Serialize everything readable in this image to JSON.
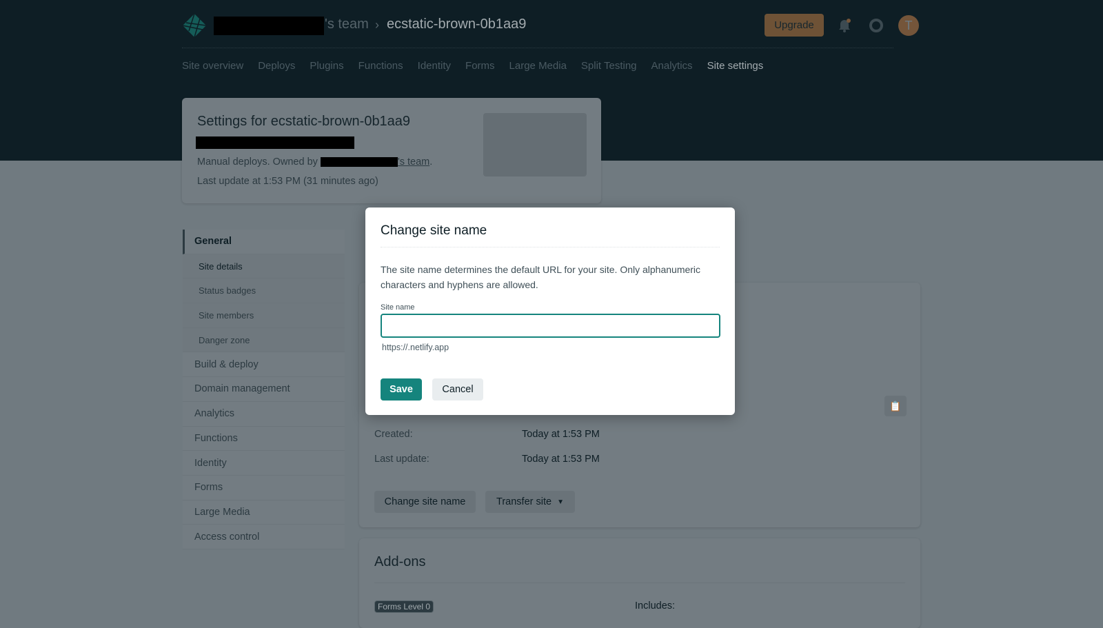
{
  "header": {
    "team_suffix": "'s team",
    "site_name": "ecstatic-brown-0b1aa9",
    "upgrade": "Upgrade",
    "avatar_initial": "T",
    "accent": "#b8834b"
  },
  "nav": [
    "Site overview",
    "Deploys",
    "Plugins",
    "Functions",
    "Identity",
    "Forms",
    "Large Media",
    "Split Testing",
    "Analytics",
    "Site settings"
  ],
  "site_card": {
    "title": "Settings for ecstatic-brown-0b1aa9",
    "owned_prefix": "Manual deploys. Owned by",
    "owned_suffix": "'s team",
    "last_update": "Last update at 1:53 PM (31 minutes ago)"
  },
  "sidebar": {
    "general": "General",
    "subs": [
      "Site details",
      "Status badges",
      "Site members",
      "Danger zone"
    ],
    "items": [
      "Build & deploy",
      "Domain management",
      "Analytics",
      "Functions",
      "Identity",
      "Forms",
      "Large Media",
      "Access control"
    ]
  },
  "details": {
    "created_label": "Created:",
    "created_value": "Today at 1:53 PM",
    "updated_label": "Last update:",
    "updated_value": "Today at 1:53 PM",
    "change_button": "Change site name",
    "transfer_button": "Transfer site"
  },
  "addons": {
    "title": "Add-ons",
    "badge": "Forms Level 0",
    "includes": "Includes:"
  },
  "modal": {
    "title": "Change site name",
    "description": "The site name determines the default URL for your site. Only alphanumeric characters and hyphens are allowed.",
    "field_label": "Site name",
    "field_value": "",
    "url_hint": "https://.netlify.app",
    "save": "Save",
    "cancel": "Cancel",
    "primary_color": "#15847d"
  }
}
